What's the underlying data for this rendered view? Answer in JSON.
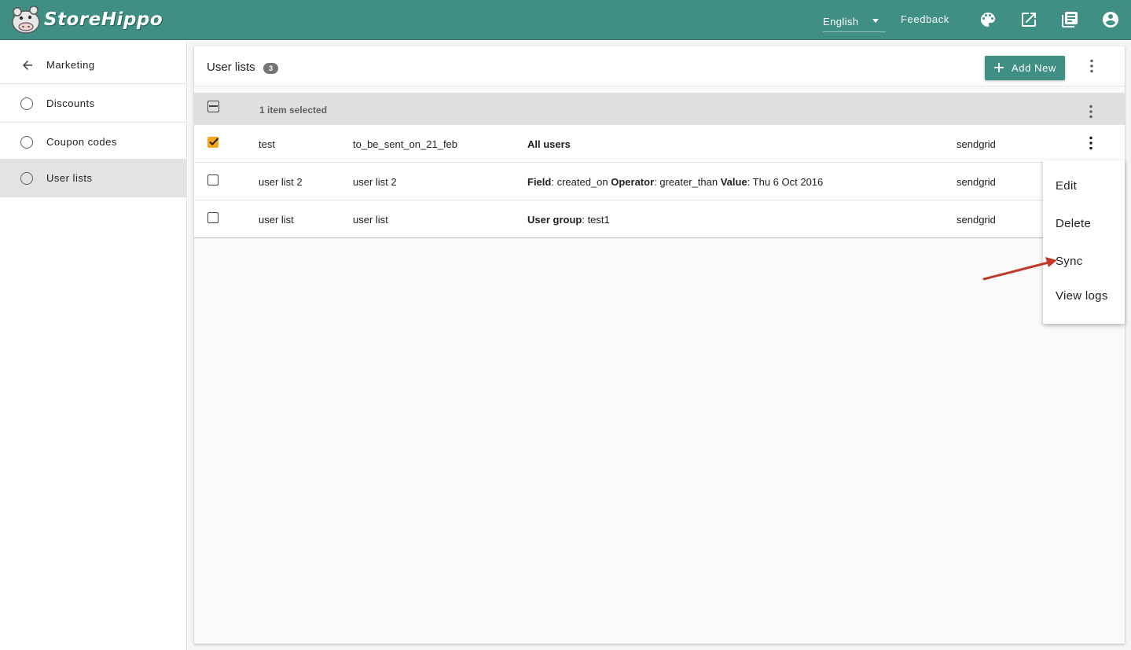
{
  "app": {
    "brand_name": "StoreHippo"
  },
  "topbar": {
    "language": "English",
    "feedback_label": "Feedback",
    "icons": [
      "palette-icon",
      "open-in-new-icon",
      "library-books-icon",
      "account-circle-icon"
    ]
  },
  "sidebar": {
    "back_label": "Marketing",
    "items": [
      {
        "label": "Discounts",
        "active": false
      },
      {
        "label": "Coupon codes",
        "active": false
      },
      {
        "label": "User lists",
        "active": true
      }
    ]
  },
  "page": {
    "title": "User lists",
    "count": "3",
    "add_new_label": "Add New"
  },
  "table": {
    "selection_text": "1 item selected",
    "rows": [
      {
        "checked": true,
        "name": "test",
        "code": "to_be_sent_on_21_feb",
        "criteria": {
          "k1": "All users",
          "v1": "",
          "k2": "",
          "v2": "",
          "k3": "",
          "v3": ""
        },
        "provider": "sendgrid"
      },
      {
        "checked": false,
        "name": "user list 2",
        "code": "user list 2",
        "criteria": {
          "k1": "Field",
          "v1": ": created_on ",
          "k2": "Operator",
          "v2": ": greater_than ",
          "k3": "Value",
          "v3": ": Thu 6 Oct 2016"
        },
        "provider": "sendgrid"
      },
      {
        "checked": false,
        "name": "user list",
        "code": "user list",
        "criteria": {
          "k1": "User group",
          "v1": ": test1",
          "k2": "",
          "v2": "",
          "k3": "",
          "v3": ""
        },
        "provider": "sendgrid"
      }
    ]
  },
  "context_menu": {
    "items": [
      "Edit",
      "Delete",
      "Sync",
      "View logs"
    ]
  },
  "colors": {
    "brand": "#3f8f84",
    "checkbox_checked": "#f5a623",
    "annotation_arrow": "#c0392b"
  }
}
